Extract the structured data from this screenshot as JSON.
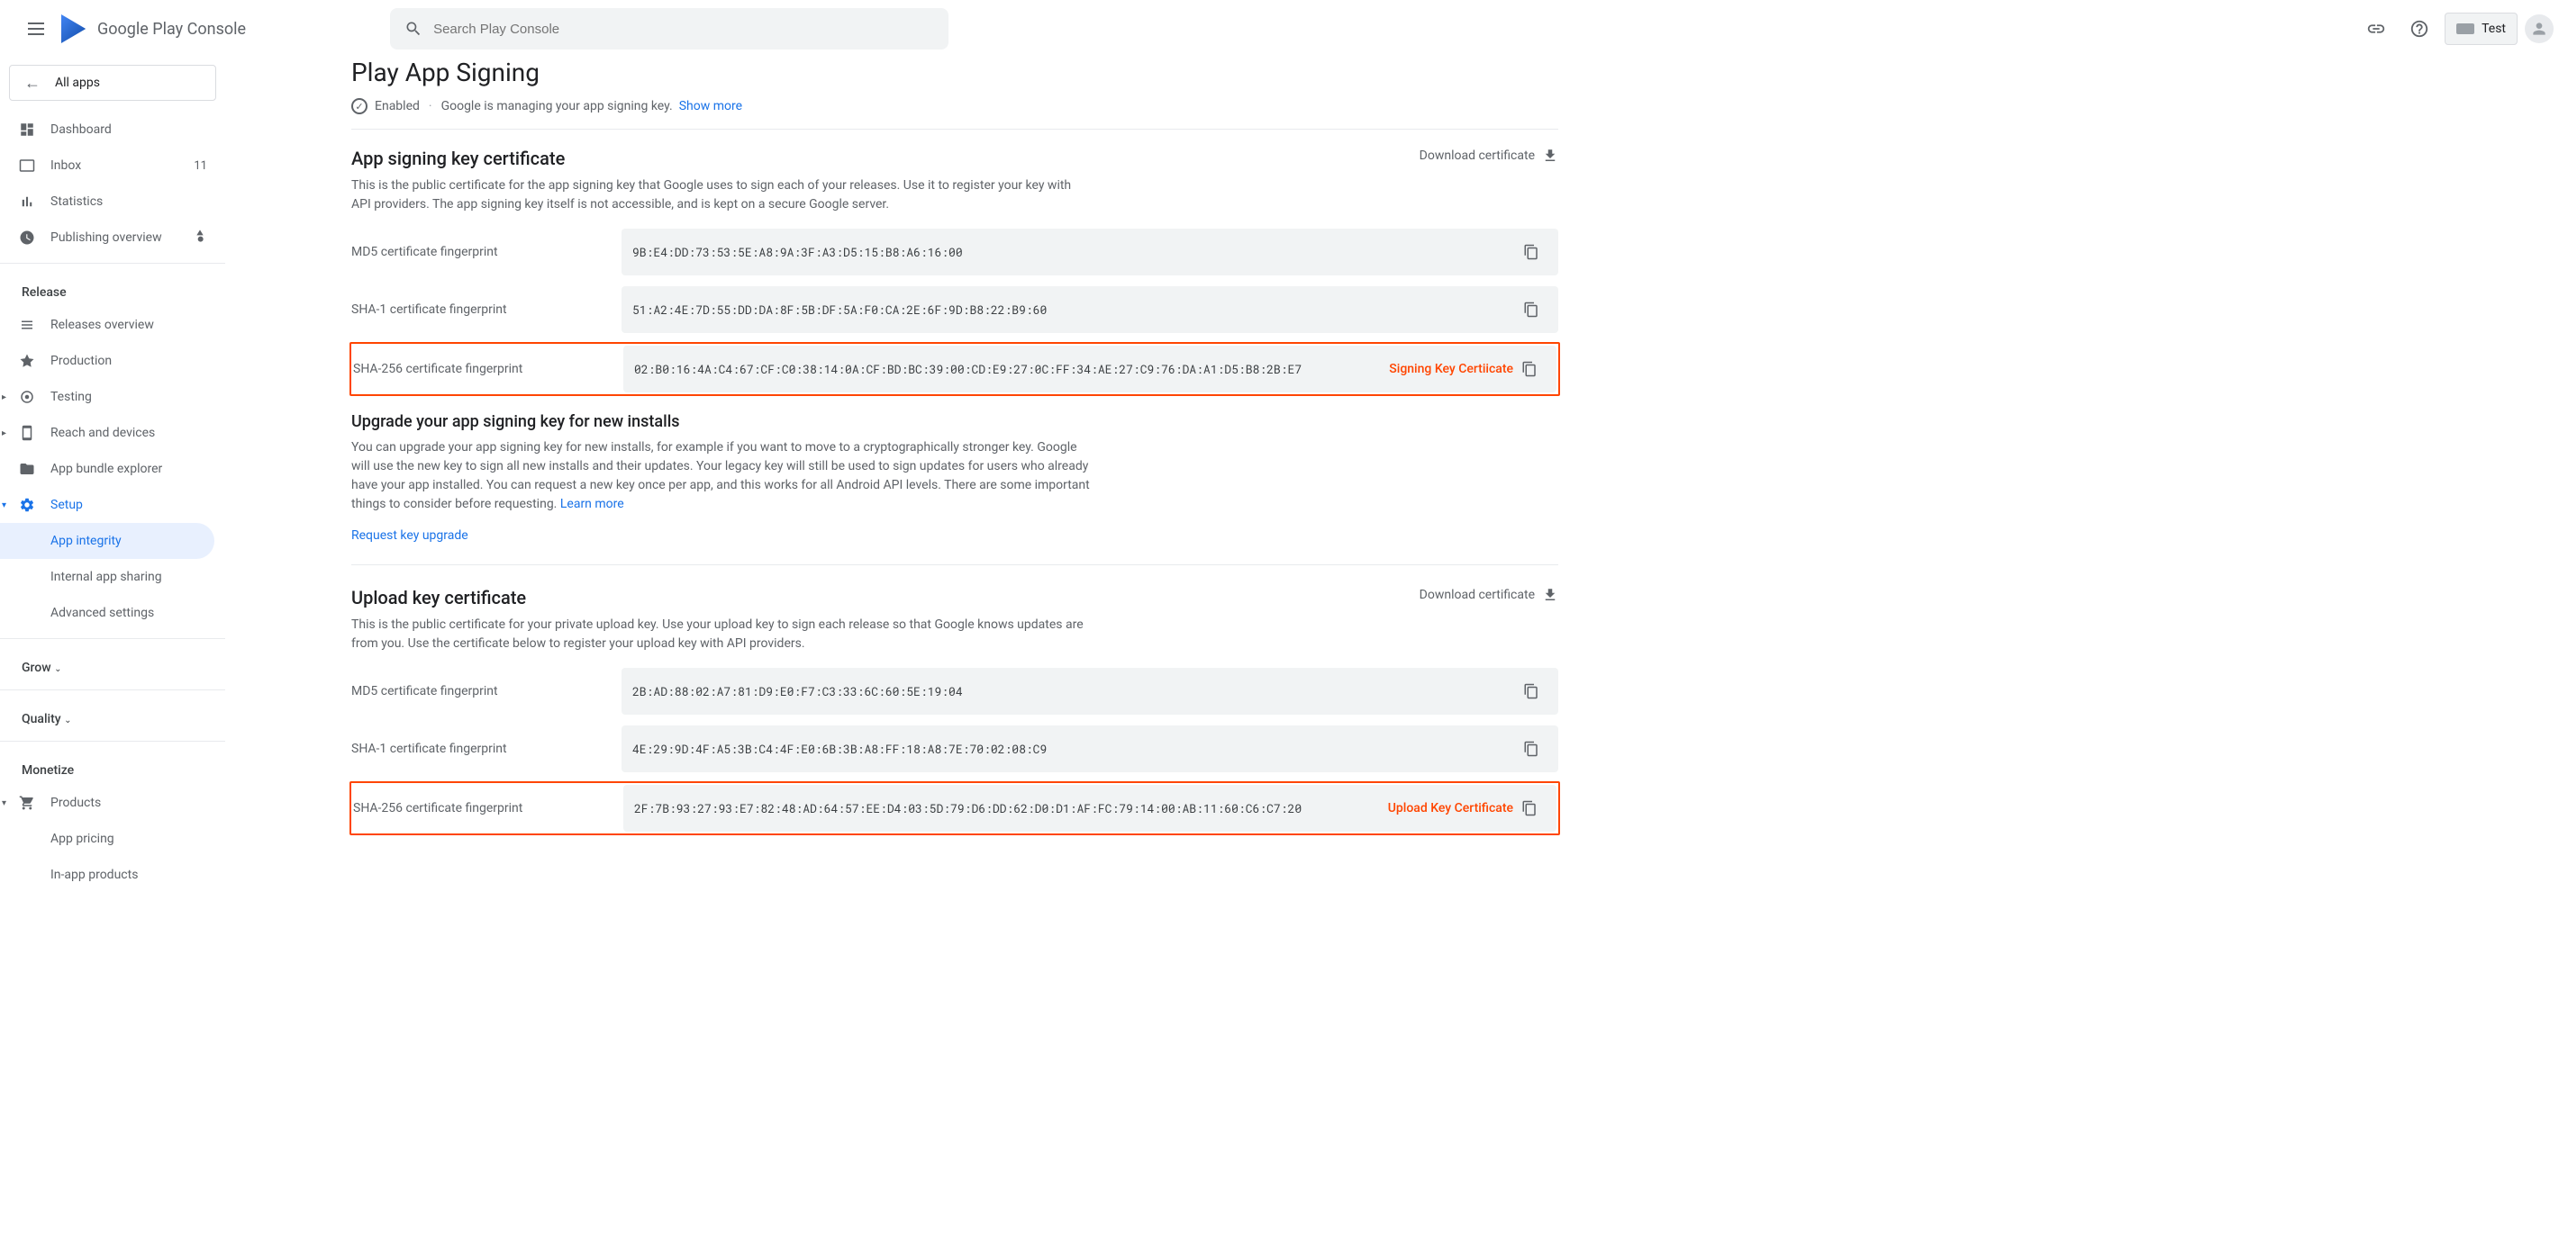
{
  "header": {
    "logo_text": "Google Play Console",
    "search_placeholder": "Search Play Console",
    "app_name": "Test"
  },
  "sidebar": {
    "all_apps": "All apps",
    "items": [
      {
        "label": "Dashboard"
      },
      {
        "label": "Inbox",
        "badge": "11"
      },
      {
        "label": "Statistics"
      },
      {
        "label": "Publishing overview"
      }
    ],
    "release_section": "Release",
    "release_items": [
      {
        "label": "Releases overview"
      },
      {
        "label": "Production"
      },
      {
        "label": "Testing"
      },
      {
        "label": "Reach and devices"
      },
      {
        "label": "App bundle explorer"
      },
      {
        "label": "Setup"
      }
    ],
    "setup_sub": [
      {
        "label": "App integrity"
      },
      {
        "label": "Internal app sharing"
      },
      {
        "label": "Advanced settings"
      }
    ],
    "grow_section": "Grow",
    "quality_section": "Quality",
    "monetize_section": "Monetize",
    "monetize_items": [
      {
        "label": "Products"
      },
      {
        "label": "App pricing"
      },
      {
        "label": "In-app products"
      }
    ]
  },
  "page": {
    "title": "Play App Signing",
    "status_enabled": "Enabled",
    "status_text": "Google is managing your app signing key.",
    "show_more": "Show more"
  },
  "signing_cert": {
    "title": "App signing key certificate",
    "desc": "This is the public certificate for the app signing key that Google uses to sign each of your releases. Use it to register your key with API providers. The app signing key itself is not accessible, and is kept on a secure Google server.",
    "download": "Download certificate",
    "md5_label": "MD5 certificate fingerprint",
    "md5_value": "9B:E4:DD:73:53:5E:A8:9A:3F:A3:D5:15:B8:A6:16:00",
    "sha1_label": "SHA-1 certificate fingerprint",
    "sha1_value": "51:A2:4E:7D:55:DD:DA:8F:5B:DF:5A:F0:CA:2E:6F:9D:B8:22:B9:60",
    "sha256_label": "SHA-256 certificate fingerprint",
    "sha256_value": "02:B0:16:4A:C4:67:CF:C0:38:14:0A:CF:BD:BC:39:00:CD:E9:27:0C:FF:34:AE:27:C9:76:DA:A1:D5:B8:2B:E7",
    "annotation": "Signing Key Certiicate"
  },
  "upgrade": {
    "title": "Upgrade your app signing key for new installs",
    "desc": "You can upgrade your app signing key for new installs, for example if you want to move to a cryptographically stronger key. Google will use the new key to sign all new installs and their updates. Your legacy key will still be used to sign updates for users who already have your app installed. You can request a new key once per app, and this works for all Android API levels. There are some important things to consider before requesting.",
    "learn_more": "Learn more",
    "request": "Request key upgrade"
  },
  "upload_cert": {
    "title": "Upload key certificate",
    "desc": "This is the public certificate for your private upload key. Use your upload key to sign each release so that Google knows updates are from you. Use the certificate below to register your upload key with API providers.",
    "download": "Download certificate",
    "md5_label": "MD5 certificate fingerprint",
    "md5_value": "2B:AD:88:02:A7:81:D9:E0:F7:C3:33:6C:60:5E:19:04",
    "sha1_label": "SHA-1 certificate fingerprint",
    "sha1_value": "4E:29:9D:4F:A5:3B:C4:4F:E0:6B:3B:A8:FF:18:A8:7E:70:02:08:C9",
    "sha256_label": "SHA-256 certificate fingerprint",
    "sha256_value": "2F:7B:93:27:93:E7:82:48:AD:64:57:EE:D4:03:5D:79:D6:DD:62:D0:D1:AF:FC:79:14:00:AB:11:60:C6:C7:20",
    "annotation": "Upload Key Certificate"
  }
}
